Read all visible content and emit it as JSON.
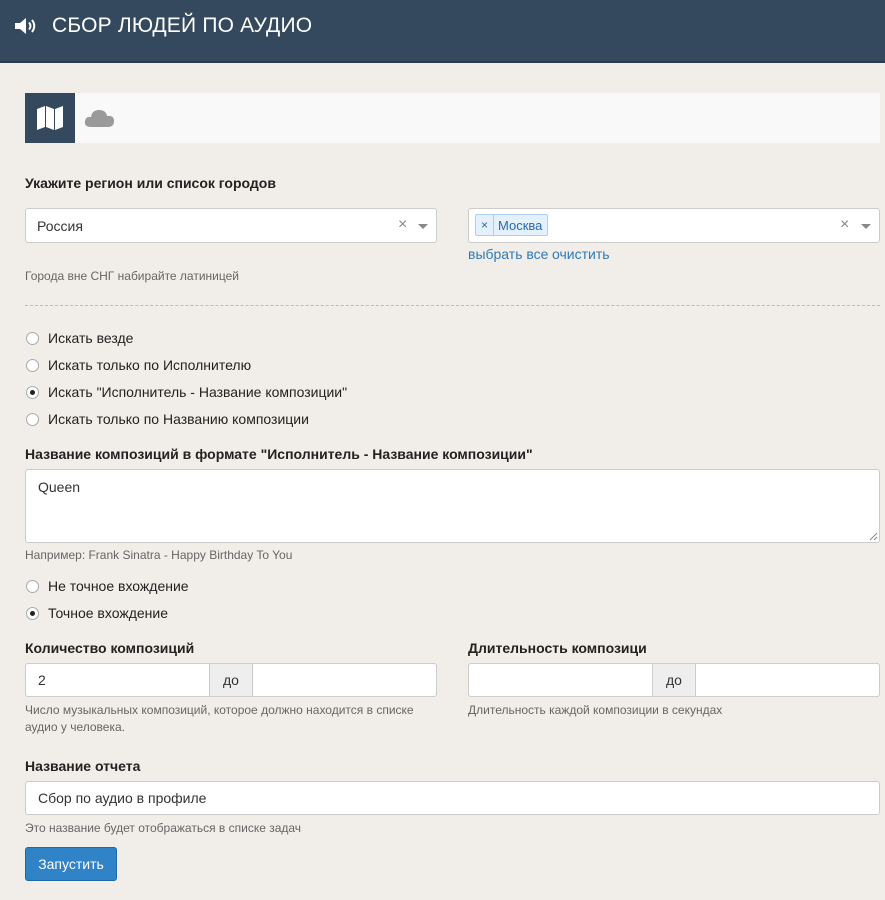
{
  "header": {
    "title": "СБОР ЛЮДЕЙ ПО АУДИО",
    "icon": "speaker-icon"
  },
  "tabs": {
    "items": [
      {
        "icon": "map-icon",
        "active": true
      },
      {
        "icon": "cloud-icon",
        "active": false
      }
    ]
  },
  "region": {
    "label": "Укажите регион или список городов",
    "country_value": "Россия",
    "cities": [
      "Москва"
    ],
    "select_all_link": "выбрать все",
    "clear_link": "очистить",
    "help": "Города вне СНГ набирайте латиницей"
  },
  "search_mode": {
    "options": [
      "Искать везде",
      "Искать только по Исполнителю",
      "Искать \"Исполнитель - Название композиции\"",
      "Искать только по Названию композиции"
    ],
    "selected_index": 2
  },
  "compositions": {
    "label": "Название композиций в формате \"Исполнитель - Название композиции\"",
    "value": "Queen",
    "help": "Например: Frank Sinatra - Happy Birthday To You"
  },
  "match_mode": {
    "options": [
      "Не точное вхождение",
      "Точное вхождение"
    ],
    "selected_index": 1
  },
  "count": {
    "label": "Количество композиций",
    "from_value": "2",
    "to_value": "",
    "separator": "до",
    "help_line1": "Число музыкальных композиций, которое должно находится в списке",
    "help_line2": "аудио у человека."
  },
  "duration": {
    "label": "Длительность композици",
    "from_value": "",
    "to_value": "",
    "separator": "до",
    "help": "Длительность каждой композиции в секундах"
  },
  "report": {
    "label": "Название отчета",
    "value": "Сбор по аудио в профиле",
    "help": "Это название будет отображаться в списке задач"
  },
  "submit": {
    "label": "Запустить"
  },
  "colors": {
    "header_bg": "#34495e",
    "page_bg": "#f1ede8",
    "button_bg": "#2f83c6",
    "link": "#2e7ab8"
  }
}
